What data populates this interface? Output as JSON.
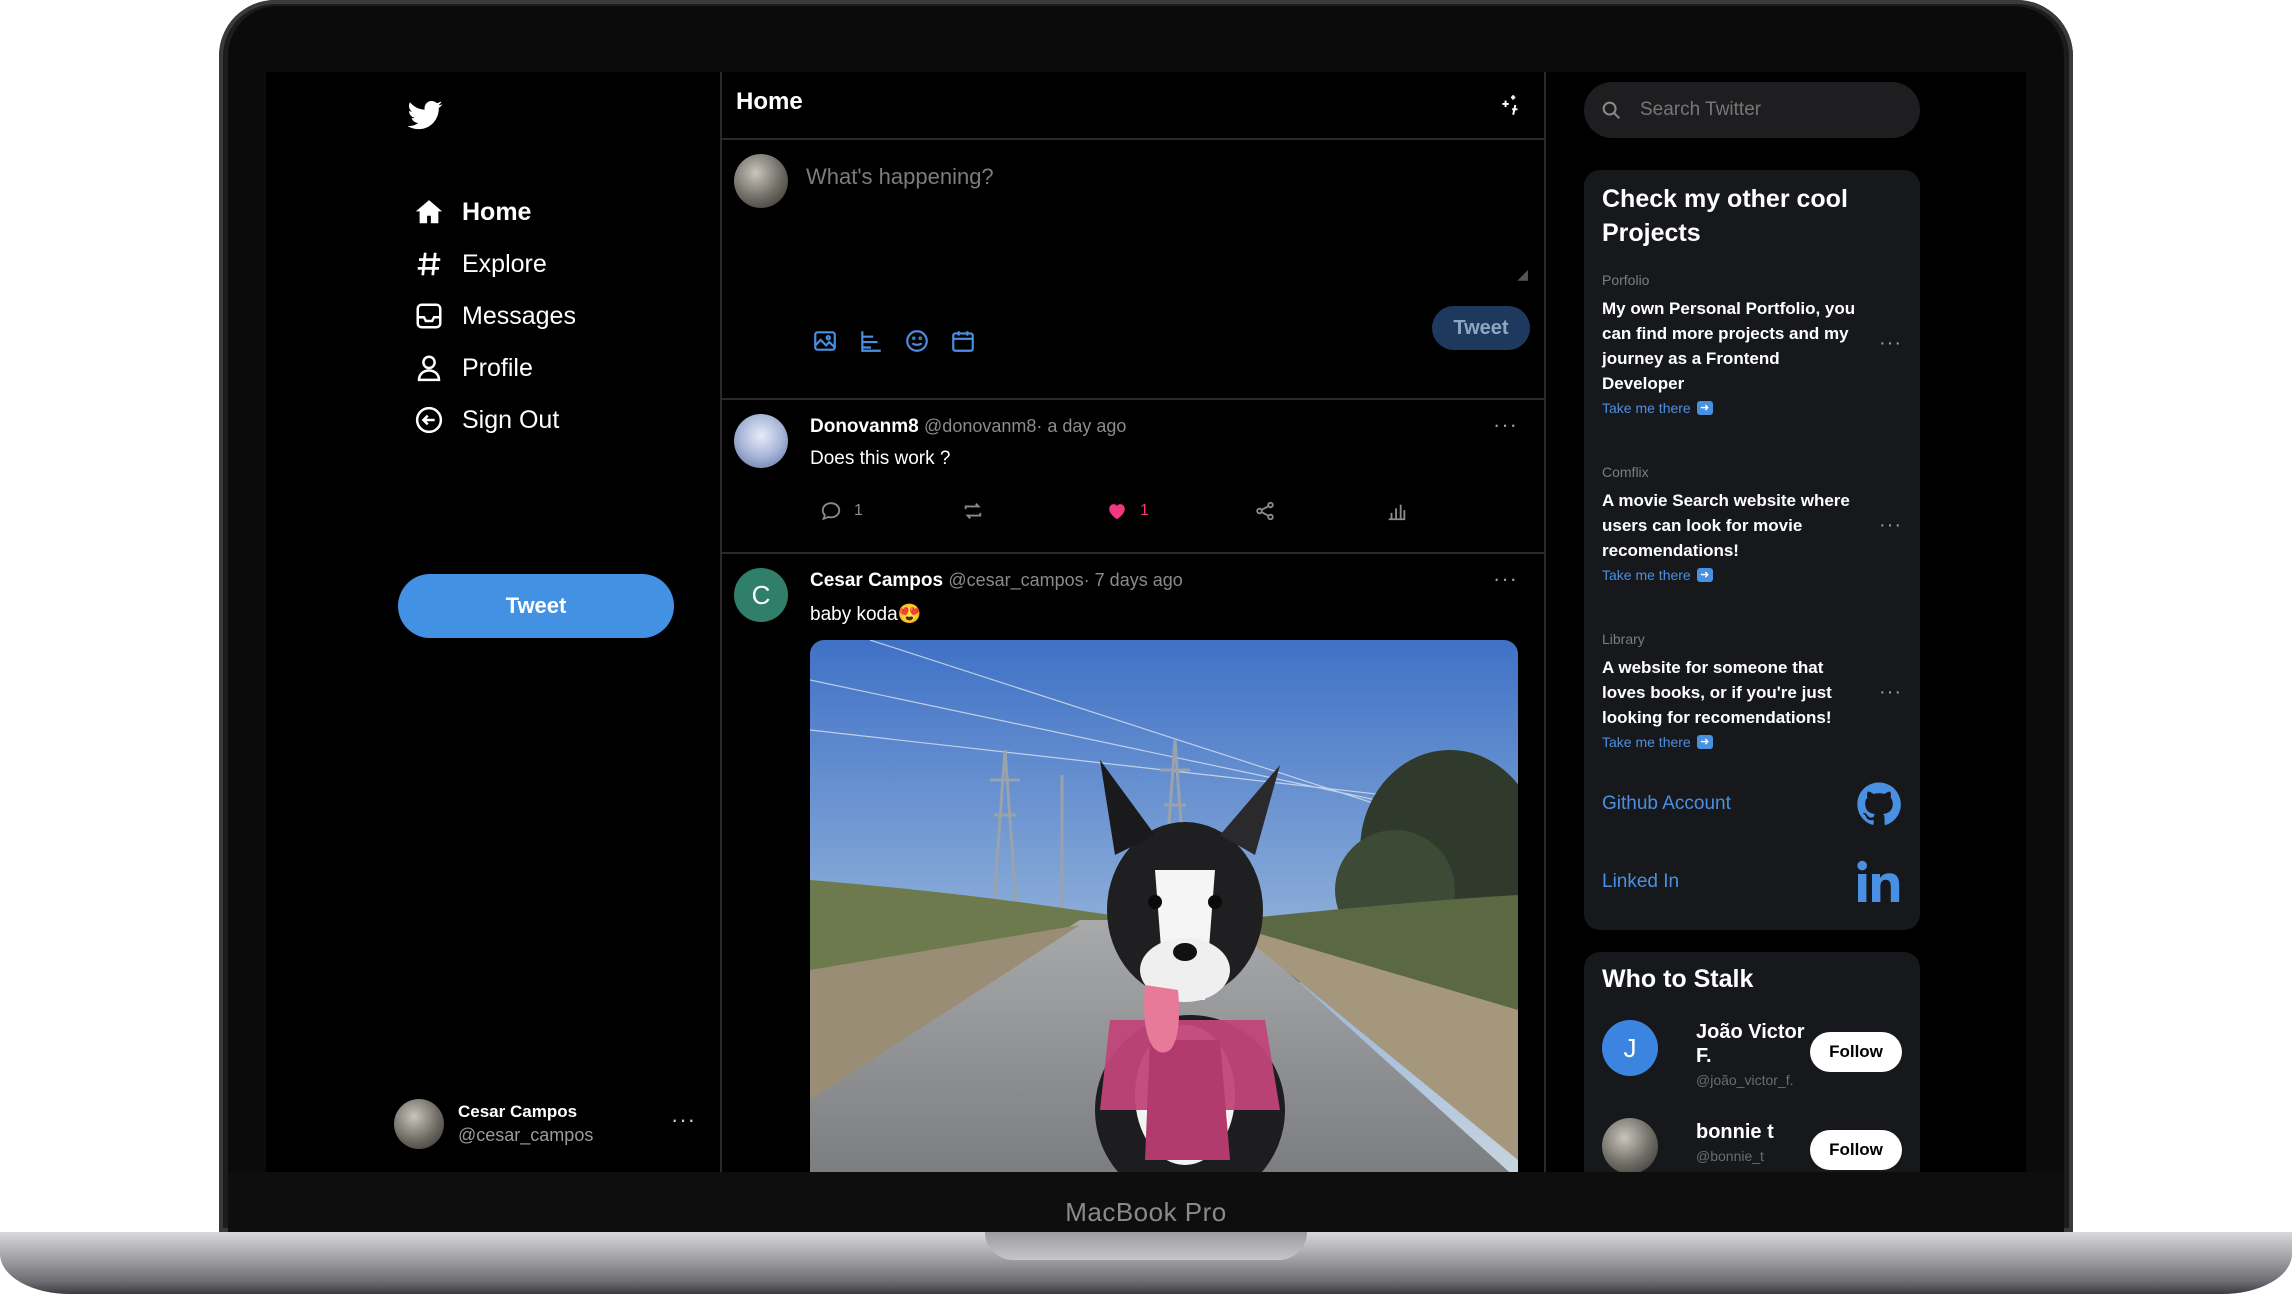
{
  "device": {
    "label": "MacBook Pro"
  },
  "nav": {
    "items": [
      {
        "label": "Home",
        "icon": "home-icon"
      },
      {
        "label": "Explore",
        "icon": "hashtag-icon"
      },
      {
        "label": "Messages",
        "icon": "inbox-icon"
      },
      {
        "label": "Profile",
        "icon": "user-icon"
      },
      {
        "label": "Sign Out",
        "icon": "sign-out-icon"
      }
    ],
    "tweet_button": "Tweet",
    "user": {
      "name": "Cesar Campos",
      "handle": "@cesar_campos",
      "menu": "···"
    }
  },
  "feed": {
    "title": "Home",
    "composer": {
      "placeholder": "What's happening?",
      "tweet_button": "Tweet"
    },
    "posts": [
      {
        "name": "Donovanm8",
        "handle": "@donovanm8",
        "time": "· a day ago",
        "text": "Does this work ?",
        "replies": "1",
        "likes": "1",
        "menu": "···"
      },
      {
        "name": "Cesar Campos",
        "handle": "@cesar_campos",
        "time": "· 7 days ago",
        "text": "baby koda😍",
        "avatar_letter": "C",
        "menu": "···"
      }
    ]
  },
  "sidebar": {
    "search_placeholder": "Search Twitter",
    "projects": {
      "title": "Check my other cool Projects",
      "items": [
        {
          "category": "Porfolio",
          "desc": "My own Personal Portfolio, you can find more projects and my journey as a Frontend Developer",
          "link": "Take me there",
          "menu": "···"
        },
        {
          "category": "Comflix",
          "desc": "A movie Search website where users can look for movie recomendations!",
          "link": "Take me there",
          "menu": "···"
        },
        {
          "category": "Library",
          "desc": "A website for someone that loves books, or if you're just looking for recomendations!",
          "link": "Take me there",
          "menu": "···"
        }
      ],
      "github": "Github Account",
      "linkedin": "Linked In"
    },
    "who": {
      "title": "Who to Stalk",
      "people": [
        {
          "name": "João Victor F.",
          "handle": "@joão_victor_f.",
          "letter": "J",
          "follow": "Follow"
        },
        {
          "name": "bonnie t",
          "handle": "@bonnie_t",
          "follow": "Follow"
        }
      ]
    }
  },
  "colors": {
    "accent": "#4291e3",
    "like": "#f0377f",
    "background": "#000000"
  }
}
